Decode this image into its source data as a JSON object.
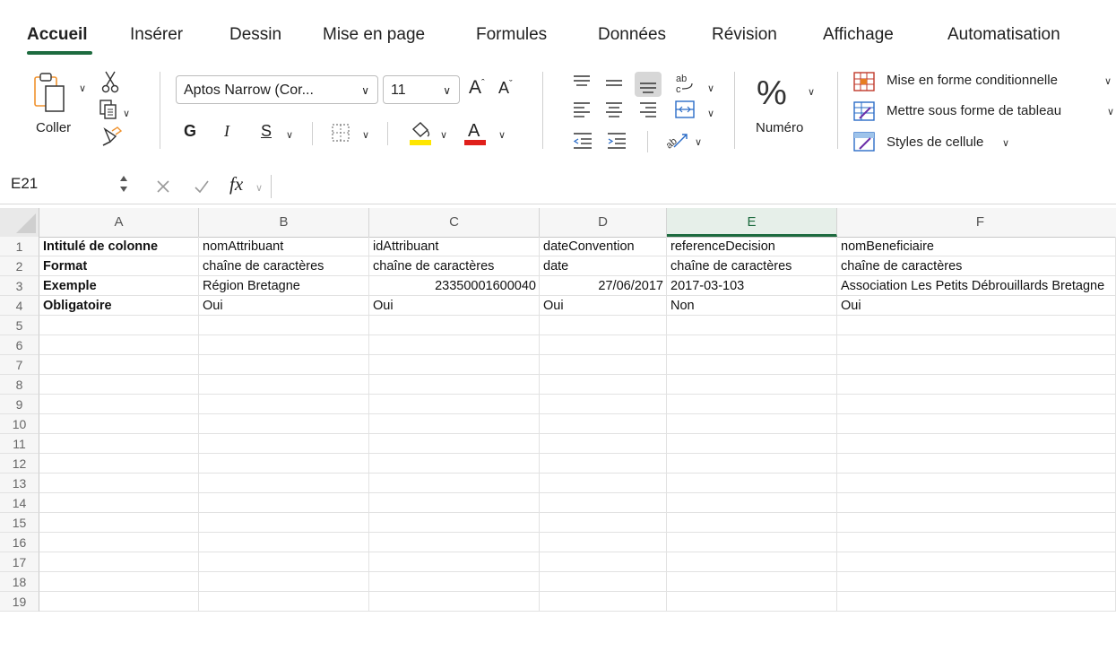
{
  "tabs": [
    {
      "label": "Accueil",
      "active": true
    },
    {
      "label": "Insérer"
    },
    {
      "label": "Dessin"
    },
    {
      "label": "Mise en page"
    },
    {
      "label": "Formules"
    },
    {
      "label": "Données"
    },
    {
      "label": "Révision"
    },
    {
      "label": "Affichage"
    },
    {
      "label": "Automatisation"
    }
  ],
  "ribbon": {
    "paste_label": "Coller",
    "font_name": "Aptos Narrow (Cor...",
    "font_size": "11",
    "bold_glyph": "G",
    "italic_glyph": "I",
    "underline_glyph": "S",
    "number_label": "Numéro",
    "conditional_format": "Mise en forme conditionnelle",
    "format_as_table": "Mettre sous forme de tableau",
    "cell_styles": "Styles de cellule",
    "fill_color": "#ffe600",
    "font_color": "#e0201b"
  },
  "formula_bar": {
    "name_box": "E21",
    "fx_label": "fx",
    "formula": ""
  },
  "grid": {
    "columns": [
      "A",
      "B",
      "C",
      "D",
      "E",
      "F"
    ],
    "selected_column": "E",
    "rows": [
      [
        "Intitulé de colonne",
        "nomAttribuant",
        "idAttribuant",
        "dateConvention",
        "referenceDecision",
        "nomBeneficiaire"
      ],
      [
        "Format",
        "chaîne de caractères",
        "chaîne de caractères",
        "date",
        "chaîne de caractères",
        "chaîne de caractères"
      ],
      [
        "Exemple",
        "Région Bretagne",
        "23350001600040",
        "27/06/2017",
        "2017-03-103",
        "Association Les Petits Débrouillards Bretagne"
      ],
      [
        "Obligatoire",
        "Oui",
        "Oui",
        "Oui",
        "Non",
        "Oui"
      ]
    ],
    "row_numbers": [
      "1",
      "2",
      "3",
      "4",
      "5",
      "6",
      "7",
      "8",
      "9",
      "10",
      "11",
      "12",
      "13",
      "14",
      "15",
      "16",
      "17",
      "18",
      "19"
    ]
  }
}
